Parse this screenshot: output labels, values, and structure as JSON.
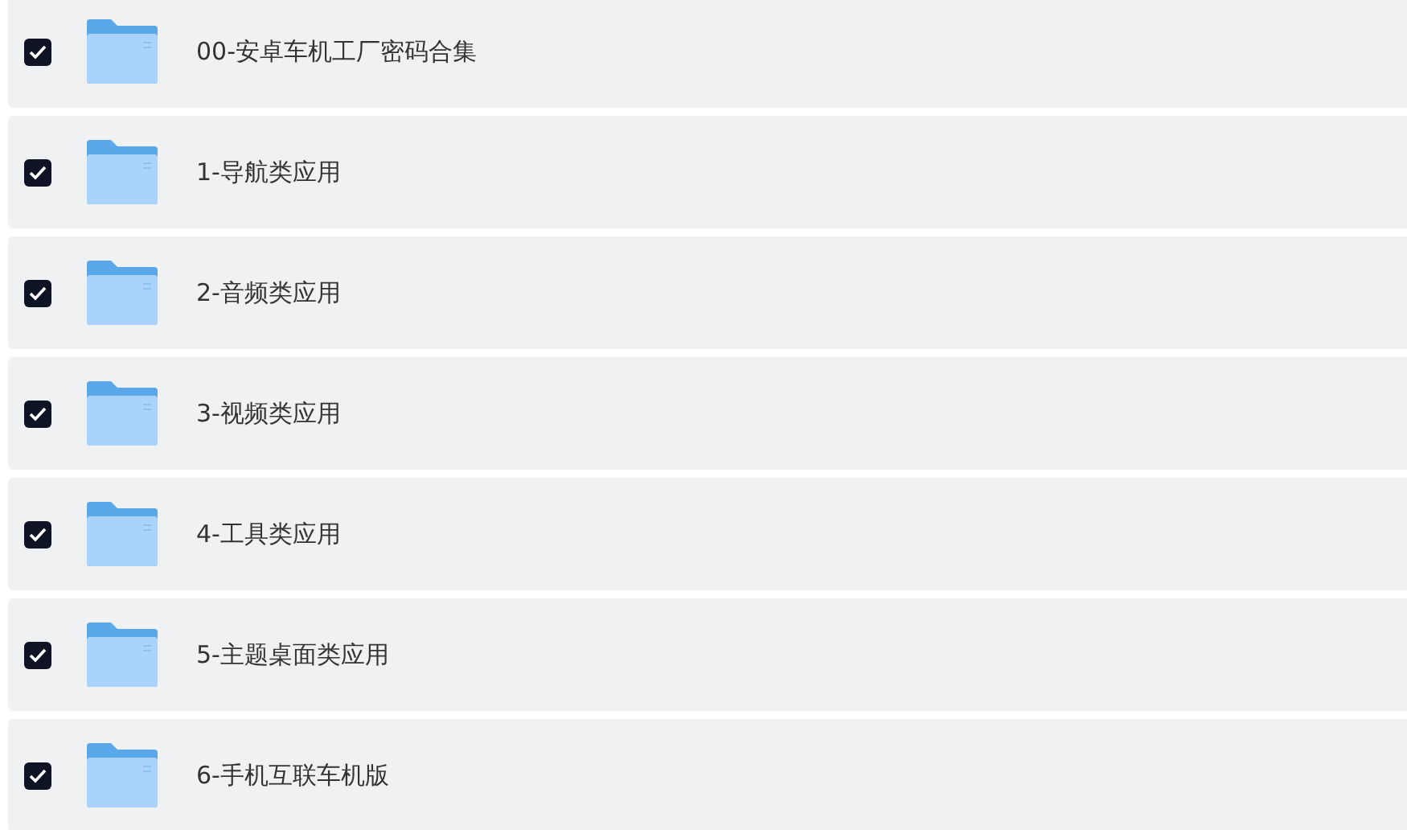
{
  "items": [
    {
      "name": "00-安卓车机工厂密码合集",
      "checked": true
    },
    {
      "name": "1-导航类应用",
      "checked": true
    },
    {
      "name": "2-音频类应用",
      "checked": true
    },
    {
      "name": "3-视频类应用",
      "checked": true
    },
    {
      "name": "4-工具类应用",
      "checked": true
    },
    {
      "name": "5-主题桌面类应用",
      "checked": true
    },
    {
      "name": "6-手机互联车机版",
      "checked": true
    }
  ]
}
